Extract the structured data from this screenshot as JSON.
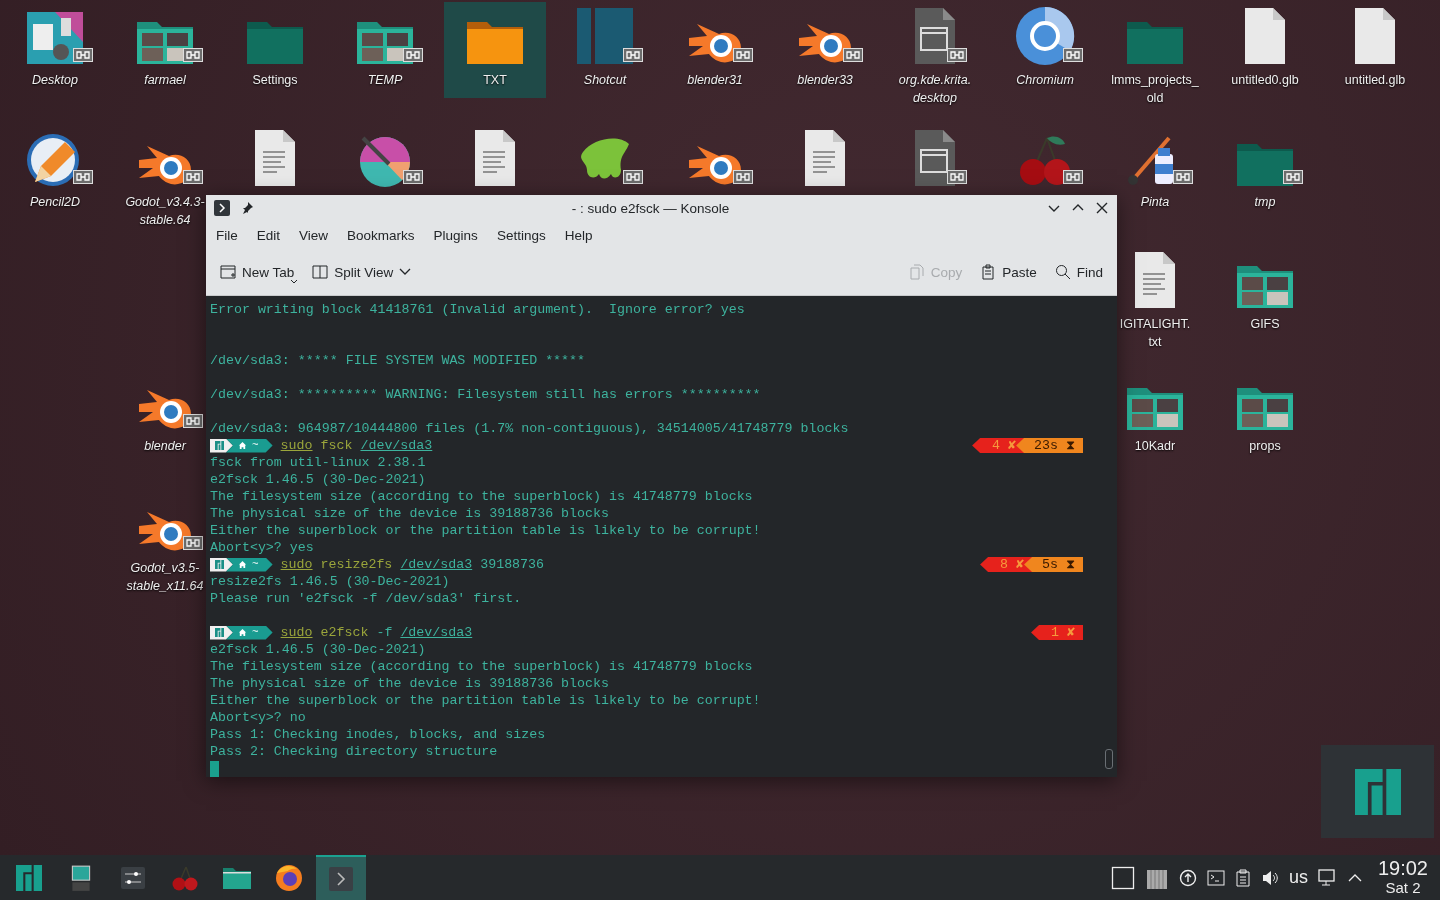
{
  "desktop": {
    "rows": [
      {
        "cells": [
          {
            "label": "Desktop",
            "kind": "photo",
            "link": true,
            "selected": false
          },
          {
            "label": "farmael",
            "kind": "photo-folder",
            "link": true,
            "selected": false
          },
          {
            "label": "Settings",
            "kind": "folder",
            "link": false,
            "selected": false
          },
          {
            "label": "TEMP",
            "kind": "photo-folder",
            "link": true,
            "selected": false
          },
          {
            "label": "TXT",
            "kind": "orange-folder",
            "link": false,
            "selected": true
          },
          {
            "label": "Shotcut",
            "kind": "shotcut",
            "link": true,
            "selected": false
          },
          {
            "label": "blender31",
            "kind": "blender",
            "link": true,
            "selected": false
          },
          {
            "label": "blender33",
            "kind": "blender",
            "link": true,
            "selected": false
          },
          {
            "label": "org.kde.krita.\ndesktop",
            "kind": "app-file",
            "link": true,
            "selected": false
          },
          {
            "label": "Chromium",
            "kind": "chromium",
            "link": true,
            "selected": false
          },
          {
            "label": "lmms_projects_\nold",
            "kind": "folder",
            "link": false,
            "selected": false
          },
          {
            "label": "untitled0.glb",
            "kind": "blank-doc",
            "link": false,
            "selected": false
          },
          {
            "label": "untitled.glb",
            "kind": "blank-doc",
            "link": false,
            "selected": false
          }
        ]
      },
      {
        "cells": [
          {
            "label": "Pencil2D",
            "kind": "pencil",
            "link": true,
            "selected": false
          },
          {
            "label": "Godot_v3.4.3-\nstable.64",
            "kind": "blender",
            "link": true,
            "selected": false
          },
          {
            "kind": "document",
            "link": false,
            "selected": false
          },
          {
            "kind": "palette",
            "link": true,
            "selected": false
          },
          {
            "kind": "document",
            "link": false,
            "selected": false
          },
          {
            "kind": "slime",
            "link": true,
            "selected": false
          },
          {
            "kind": "blender",
            "link": true,
            "selected": false
          },
          {
            "kind": "document",
            "link": false,
            "selected": false
          },
          {
            "kind": "app-file",
            "link": true,
            "selected": false
          },
          {
            "kind": "cherry",
            "link": true,
            "selected": false
          },
          {
            "label": "Pinta",
            "kind": "pinta",
            "link": true,
            "selected": false
          },
          {
            "label": "tmp",
            "kind": "folder",
            "link": true,
            "selected": false
          },
          null
        ]
      },
      {
        "cells": [
          null,
          null,
          null,
          null,
          null,
          null,
          null,
          null,
          null,
          null,
          {
            "label": "IGITALIGHT.\ntxt",
            "kind": "document",
            "link": false,
            "selected": false
          },
          {
            "label": "GIFS",
            "kind": "photo-folder",
            "link": false,
            "selected": false
          },
          null
        ]
      },
      {
        "cells": [
          null,
          {
            "label": "blender",
            "kind": "blender",
            "link": true,
            "selected": false
          },
          null,
          null,
          null,
          null,
          null,
          null,
          null,
          null,
          {
            "label": "10Kadr",
            "kind": "photo-folder",
            "link": false,
            "selected": false
          },
          {
            "label": "props",
            "kind": "photo-folder",
            "link": false,
            "selected": false
          },
          null
        ]
      },
      {
        "cells": [
          null,
          {
            "label": "Godot_v3.5-\nstable_x11.64",
            "kind": "blender",
            "link": true,
            "selected": false
          },
          null,
          null,
          null,
          null,
          null,
          null,
          null,
          null,
          null,
          null,
          null
        ]
      }
    ]
  },
  "window": {
    "title": "- : sudo e2fsck — Konsole",
    "menu": [
      "File",
      "Edit",
      "View",
      "Bookmarks",
      "Plugins",
      "Settings",
      "Help"
    ],
    "toolbar_left": [
      {
        "label": "New Tab",
        "kind": "new-tab",
        "disabled": false
      },
      {
        "label": "Split View",
        "kind": "split",
        "disabled": false
      }
    ],
    "toolbar_right": [
      {
        "label": "Copy",
        "kind": "copy",
        "disabled": true
      },
      {
        "label": "Paste",
        "kind": "paste",
        "disabled": false
      },
      {
        "label": "Find",
        "kind": "find",
        "disabled": false
      }
    ],
    "terminal": {
      "dir": "~",
      "lines": [
        {
          "kind": "text",
          "text": "Error writing block 41418761 (Invalid argument).  Ignore error? yes"
        },
        {
          "kind": "blank"
        },
        {
          "kind": "blank"
        },
        {
          "kind": "text",
          "text": "/dev/sda3: ***** FILE SYSTEM WAS MODIFIED *****"
        },
        {
          "kind": "blank"
        },
        {
          "kind": "text",
          "text": "/dev/sda3: ********** WARNING: Filesystem still has errors **********"
        },
        {
          "kind": "blank"
        },
        {
          "kind": "text",
          "text": "/dev/sda3: 964987/10444800 files (1.7% non-contiguous), 34514005/41748779 blocks"
        },
        {
          "kind": "prompt",
          "command": [
            {
              "text": "sudo",
              "kind": "sudo"
            },
            {
              "text": "fsck",
              "kind": "program"
            },
            {
              "text": "/dev/sda3",
              "kind": "path"
            }
          ],
          "status": "4 ✘",
          "duration": "23s ⧗"
        },
        {
          "kind": "text",
          "text": "fsck from util-linux 2.38.1"
        },
        {
          "kind": "text",
          "text": "e2fsck 1.46.5 (30-Dec-2021)"
        },
        {
          "kind": "text",
          "text": "The filesystem size (according to the superblock) is 41748779 blocks"
        },
        {
          "kind": "text",
          "text": "The physical size of the device is 39188736 blocks"
        },
        {
          "kind": "text",
          "text": "Either the superblock or the partition table is likely to be corrupt!"
        },
        {
          "kind": "text",
          "text": "Abort<y>? yes"
        },
        {
          "kind": "prompt",
          "command": [
            {
              "text": "sudo",
              "kind": "sudo"
            },
            {
              "text": "resize2fs",
              "kind": "program"
            },
            {
              "text": "/dev/sda3",
              "kind": "path"
            },
            {
              "text": "39188736",
              "kind": "argument"
            }
          ],
          "status": "8 ✘",
          "duration": "5s ⧗"
        },
        {
          "kind": "text",
          "text": "resize2fs 1.46.5 (30-Dec-2021)"
        },
        {
          "kind": "text",
          "text": "Please run 'e2fsck -f /dev/sda3' first."
        },
        {
          "kind": "blank"
        },
        {
          "kind": "prompt",
          "command": [
            {
              "text": "sudo",
              "kind": "sudo"
            },
            {
              "text": "e2fsck",
              "kind": "program"
            },
            {
              "text": "-f",
              "kind": "argument"
            },
            {
              "text": "/dev/sda3",
              "kind": "path"
            }
          ],
          "status": "1 ✘"
        },
        {
          "kind": "text",
          "text": "e2fsck 1.46.5 (30-Dec-2021)"
        },
        {
          "kind": "text",
          "text": "The filesystem size (according to the superblock) is 41748779 blocks"
        },
        {
          "kind": "text",
          "text": "The physical size of the device is 39188736 blocks"
        },
        {
          "kind": "text",
          "text": "Either the superblock or the partition table is likely to be corrupt!"
        },
        {
          "kind": "text",
          "text": "Abort<y>? no"
        },
        {
          "kind": "text",
          "text": "Pass 1: Checking inodes, blocks, and sizes"
        },
        {
          "kind": "text",
          "text": "Pass 2: Checking directory structure"
        },
        {
          "kind": "cursor"
        }
      ]
    }
  },
  "taskbar": {
    "items": [
      {
        "kind": "manjaro",
        "selected": false
      },
      {
        "kind": "desktop",
        "selected": false
      },
      {
        "kind": "mixer",
        "selected": false
      },
      {
        "kind": "cherry",
        "selected": false
      },
      {
        "kind": "files",
        "selected": false
      },
      {
        "kind": "firefox",
        "selected": false
      },
      {
        "kind": "konsole",
        "selected": true
      }
    ],
    "tray": {
      "keyboard": "us",
      "time": "19:02",
      "date": "Sat 2"
    }
  }
}
